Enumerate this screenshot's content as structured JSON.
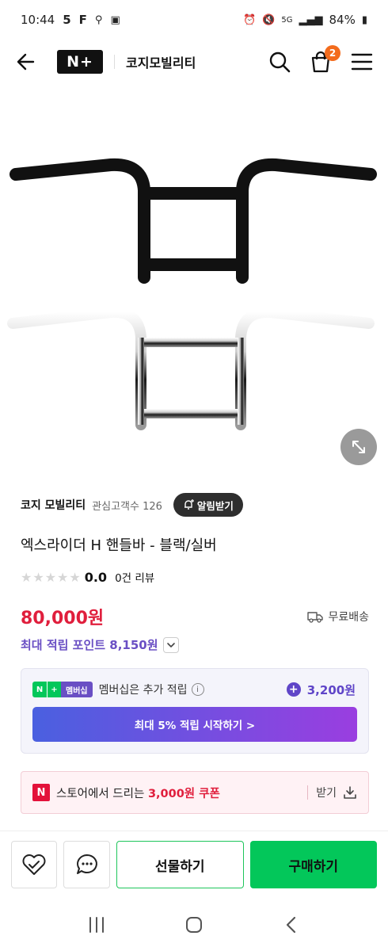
{
  "status_bar": {
    "time": "10:44",
    "indicators": [
      "5",
      "F"
    ],
    "network": "5G",
    "battery": "84%"
  },
  "header": {
    "logo_text": "N+",
    "store_name": "코지모빌리티",
    "cart_count": "2"
  },
  "store": {
    "name": "코지 모빌리티",
    "fans": "관심고객수 126",
    "alarm_label": "알림받기"
  },
  "product": {
    "title": "엑스라이더 H 핸들바 - 블랙/실버",
    "stars": "★★★★★",
    "rating": "0.0",
    "reviews": "0건 리뷰",
    "price": "80,000원",
    "shipping": "무료배송",
    "max_points": "최대 적립 포인트 8,150원"
  },
  "membership": {
    "badge_text": "멤버십",
    "text": "멤버십은 추가 적립",
    "amount": "3,200원",
    "cta": "최대 5% 적립 시작하기 >"
  },
  "coupon": {
    "prefix": "스토어에서 드리는 ",
    "amount": "3,000원 쿠폰",
    "download_label": "받기"
  },
  "actions": {
    "gift": "선물하기",
    "buy": "구매하기"
  },
  "colors": {
    "price": "#e01e3c",
    "naver_green": "#03c75a",
    "point_purple": "#6a4fc4"
  }
}
